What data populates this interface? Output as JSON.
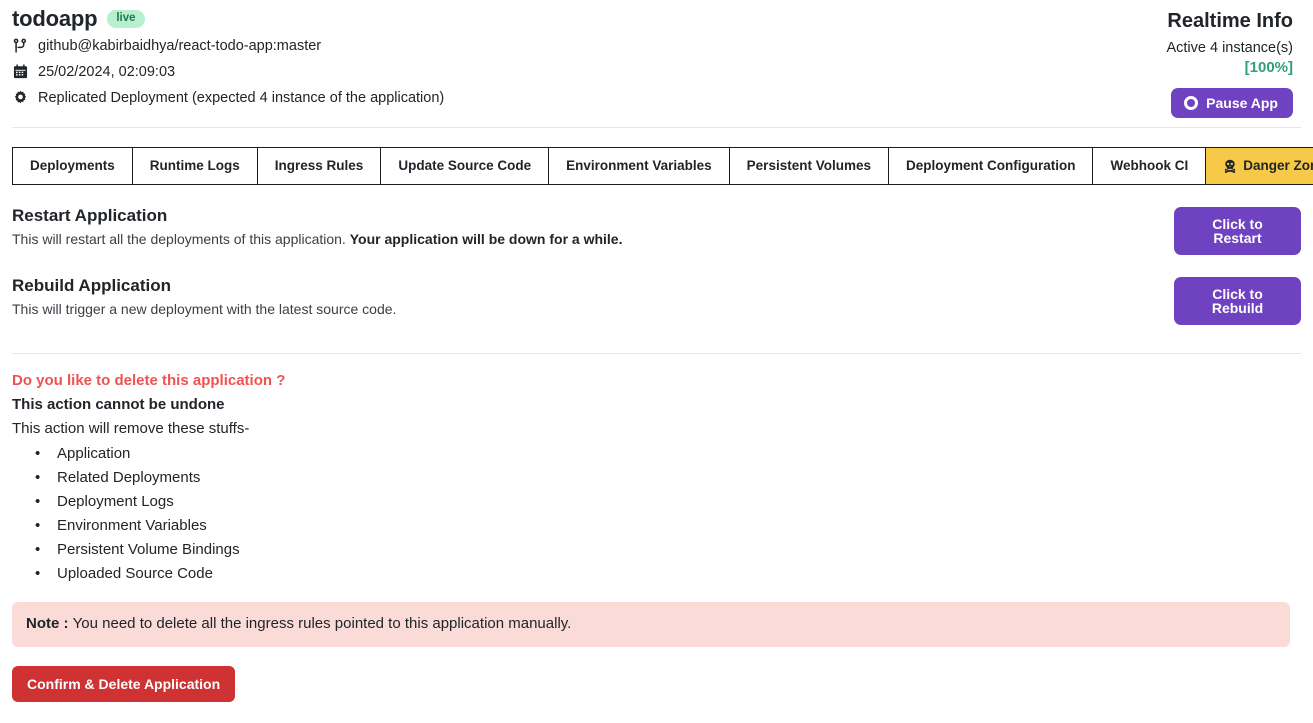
{
  "header": {
    "app_name": "todoapp",
    "status_badge": "live",
    "source_repo": "github@kabirbaidhya/react-todo-app:master",
    "deployed_at": "25/02/2024, 02:09:03",
    "deployment_type": "Replicated Deployment (expected 4 instance of the application)",
    "icons": {
      "repo": "git-branch-icon",
      "date": "calendar-icon",
      "deployment": "gear-icon"
    }
  },
  "realtime": {
    "title": "Realtime Info",
    "instances": "Active 4 instance(s)",
    "percent": "[100%]",
    "pause_label": "Pause App",
    "pause_icon": "circle-pause-icon",
    "accent_color": "#6f42c1",
    "percent_color": "#2e9e7e"
  },
  "tabs": [
    {
      "label": "Deployments",
      "active": false
    },
    {
      "label": "Runtime Logs",
      "active": false
    },
    {
      "label": "Ingress Rules",
      "active": false
    },
    {
      "label": "Update Source Code",
      "active": false
    },
    {
      "label": "Environment Variables",
      "active": false
    },
    {
      "label": "Persistent Volumes",
      "active": false
    },
    {
      "label": "Deployment Configuration",
      "active": false
    },
    {
      "label": "Webhook CI",
      "active": false
    },
    {
      "label": "Danger Zone",
      "active": true,
      "icon": "skull-icon",
      "active_color": "#f7c948"
    }
  ],
  "restart": {
    "title": "Restart Application",
    "desc_plain": "This will restart all the deployments of this application. ",
    "desc_bold": "Your application will be down for a while.",
    "button": "Click to Restart"
  },
  "rebuild": {
    "title": "Rebuild Application",
    "desc_plain": "This will trigger a new deployment with the latest source code.",
    "button": "Click to Rebuild"
  },
  "delete": {
    "question": "Do you like to delete this application ?",
    "cannot_undo": "This action cannot be undone",
    "lead": "This action will remove these stuffs-",
    "items": [
      "Application",
      "Related Deployments",
      "Deployment Logs",
      "Environment Variables",
      "Persistent Volume Bindings",
      "Uploaded Source Code"
    ],
    "note_label": "Note : ",
    "note_text": "You need to delete all the ingress rules pointed to this application manually.",
    "note_bg": "#fadbd8",
    "button": "Confirm & Delete Application",
    "button_color": "#cf3232",
    "question_color": "#ef5350"
  }
}
